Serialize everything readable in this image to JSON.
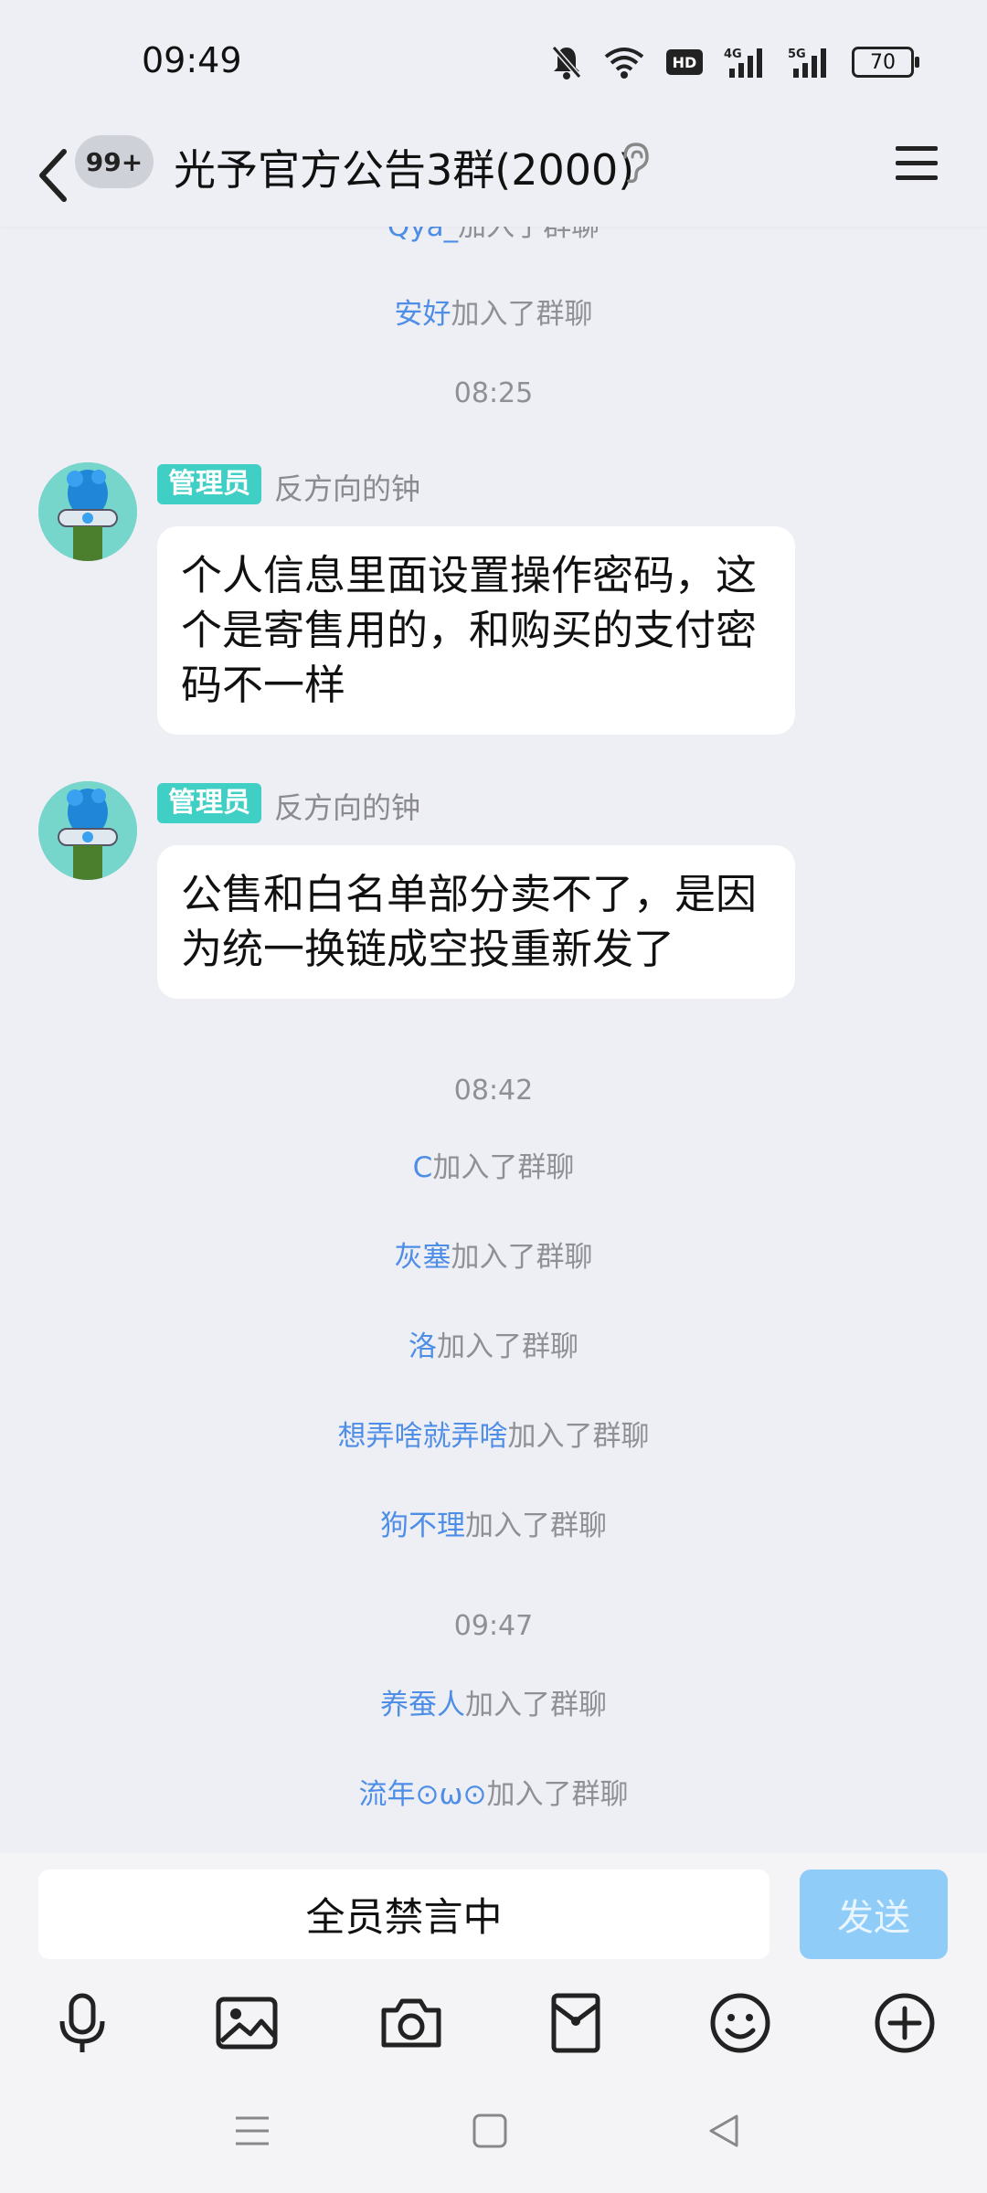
{
  "status_bar": {
    "time": "09:49",
    "battery": "70",
    "net1": "4G",
    "net2": "5G"
  },
  "header": {
    "back_badge": "99+",
    "title": "光予官方公告3群(2000)"
  },
  "chat": {
    "top_partial": {
      "nick": "Qya_",
      "text": "加入了群聊"
    },
    "join_1": {
      "nick": "安好",
      "text": "加入了群聊"
    },
    "time_1": "08:25",
    "messages": [
      {
        "role": "管理员",
        "sender": "反方向的钟",
        "text": "个人信息里面设置操作密码，这个是寄售用的，和购买的支付密码不一样"
      },
      {
        "role": "管理员",
        "sender": "反方向的钟",
        "text": "公售和白名单部分卖不了，是因为统一换链成空投重新发了"
      }
    ],
    "time_2": "08:42",
    "joins_2": [
      {
        "nick": "C",
        "text": "加入了群聊"
      },
      {
        "nick": "灰塞",
        "text": "加入了群聊"
      },
      {
        "nick": "洛",
        "text": "加入了群聊"
      },
      {
        "nick": "想弄啥就弄啥",
        "text": "加入了群聊"
      },
      {
        "nick": "狗不理",
        "text": "加入了群聊"
      }
    ],
    "time_3": "09:47",
    "joins_3": [
      {
        "nick": "养蚕人",
        "text": "加入了群聊"
      },
      {
        "nick": "流年⊙ω⊙",
        "text": "加入了群聊"
      }
    ]
  },
  "input": {
    "muted_text": "全员禁言中",
    "send_label": "发送"
  },
  "toolbar": [
    "microphone-icon",
    "image-icon",
    "camera-icon",
    "red-packet-icon",
    "emoji-icon",
    "plus-icon"
  ],
  "colors": {
    "accent": "#4e8ee6",
    "admin_badge": "#3fcfc4",
    "send_disabled": "#8fcdf8",
    "background": "#eeeff4"
  }
}
